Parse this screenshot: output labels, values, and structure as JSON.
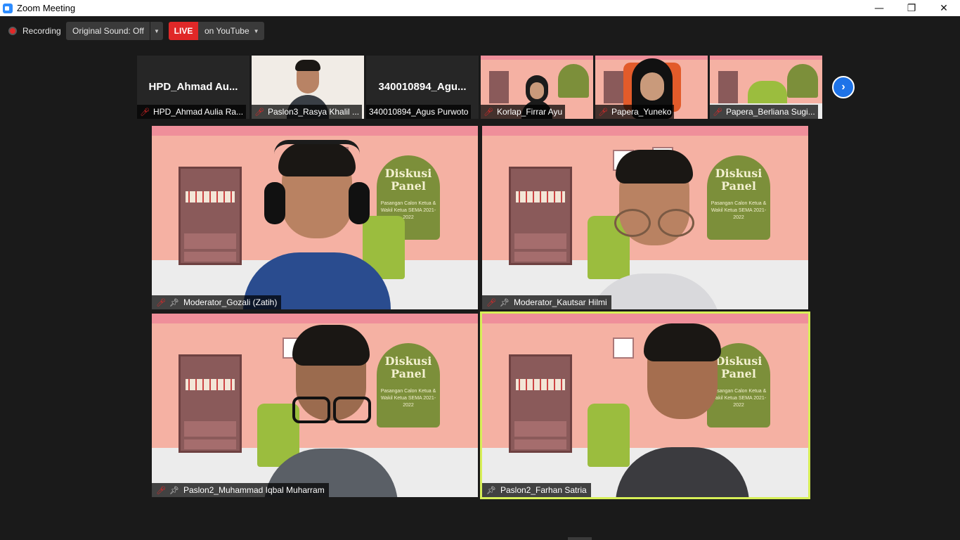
{
  "window": {
    "title": "Zoom Meeting",
    "minimize": "—",
    "restore": "❐",
    "close": "✕"
  },
  "toolbar": {
    "recording_label": "Recording",
    "original_sound_label": "Original Sound: Off",
    "live_label": "LIVE",
    "stream_target_label": "on YouTube"
  },
  "strip": {
    "tiles": [
      {
        "display_name": "HPD_Ahmad  Au...",
        "caption": "HPD_Ahmad Aulia Ra...",
        "video": false
      },
      {
        "display_name": "",
        "caption": "Paslon3_Rasya Khalil ...",
        "video": true
      },
      {
        "display_name": "340010894_Agu...",
        "caption": "340010894_Agus Purwoto",
        "video": false
      },
      {
        "display_name": "",
        "caption": "Korlap_Firrar Ayu",
        "video": true
      },
      {
        "display_name": "",
        "caption": "Papera_Yuneko",
        "video": true
      },
      {
        "display_name": "",
        "caption": "Papera_Berliana Sugi...",
        "video": true
      }
    ],
    "next_icon": "chevron-right-icon"
  },
  "gallery": {
    "tiles": [
      {
        "caption": "Moderator_Gozali (Zatih)",
        "muted": true,
        "pinned": true
      },
      {
        "caption": "Moderator_Kautsar Hilmi",
        "muted": true,
        "pinned": true
      },
      {
        "caption": "Paslon2_Muhammad Iqbal Muharram",
        "muted": true,
        "pinned": true
      },
      {
        "caption": "Paslon2_Farhan Satria",
        "muted": false,
        "pinned": true,
        "active_speaker": true
      }
    ],
    "poster": {
      "line1": "Diskusi",
      "line2": "Panel",
      "subtitle": "Pasangan Calon Ketua & Wakil Ketua SEMA 2021-2022"
    }
  },
  "colors": {
    "live": "#e02828",
    "active_border": "#d7ef57",
    "next_button": "#1e73e8"
  }
}
